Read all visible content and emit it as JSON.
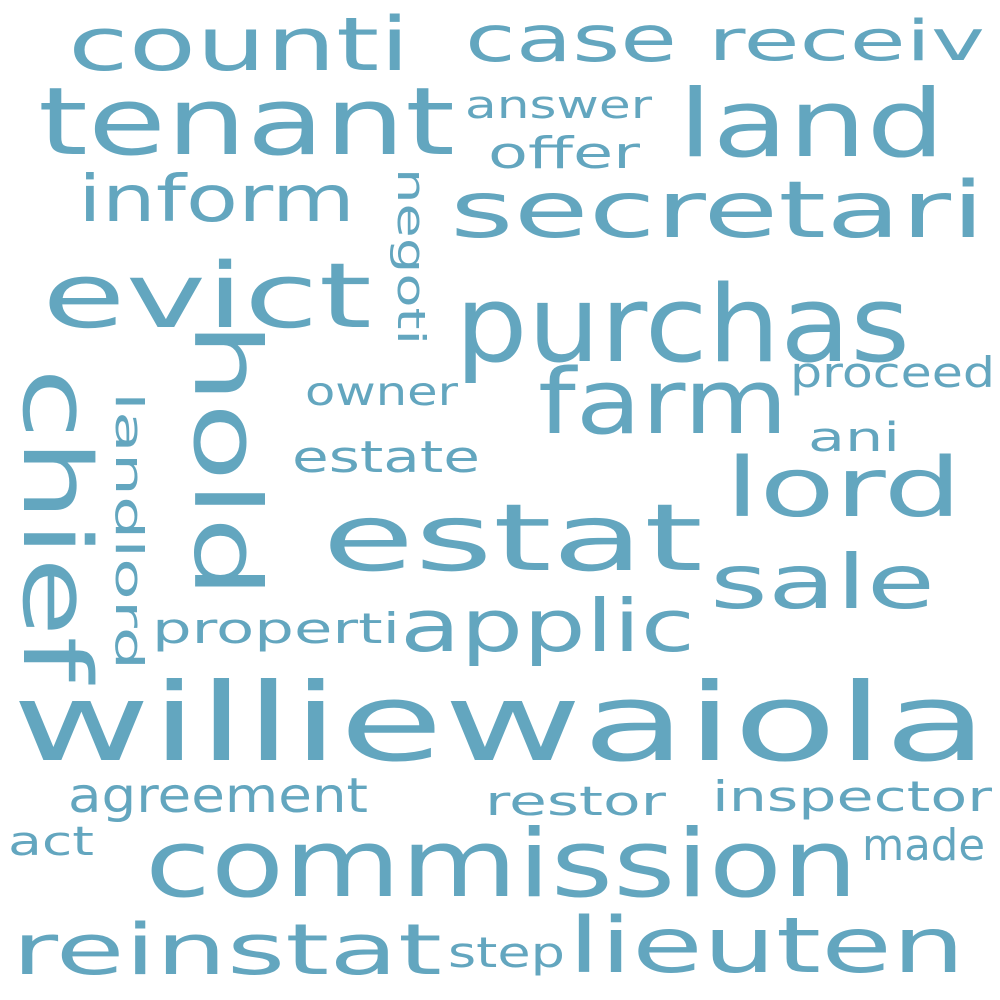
{
  "colors": {
    "background": "#ffffff",
    "word": "#63a6bf"
  },
  "words": [
    {
      "text": "counti"
    },
    {
      "text": "case"
    },
    {
      "text": "receiv"
    },
    {
      "text": "tenant"
    },
    {
      "text": "land"
    },
    {
      "text": "answer"
    },
    {
      "text": "offer"
    },
    {
      "text": "inform"
    },
    {
      "text": "secretari"
    },
    {
      "text": "negoti"
    },
    {
      "text": "evict"
    },
    {
      "text": "purchas"
    },
    {
      "text": "hold"
    },
    {
      "text": "chief"
    },
    {
      "text": "farm"
    },
    {
      "text": "proceed"
    },
    {
      "text": "owner"
    },
    {
      "text": "landlord"
    },
    {
      "text": "ani"
    },
    {
      "text": "lord"
    },
    {
      "text": "estate"
    },
    {
      "text": "estat"
    },
    {
      "text": "sale"
    },
    {
      "text": "properti"
    },
    {
      "text": "applic"
    },
    {
      "text": "williewaiola"
    },
    {
      "text": "agreement"
    },
    {
      "text": "restor"
    },
    {
      "text": "inspector"
    },
    {
      "text": "act"
    },
    {
      "text": "commission"
    },
    {
      "text": "made"
    },
    {
      "text": "reinstat"
    },
    {
      "text": "step"
    },
    {
      "text": "lieuten"
    }
  ]
}
